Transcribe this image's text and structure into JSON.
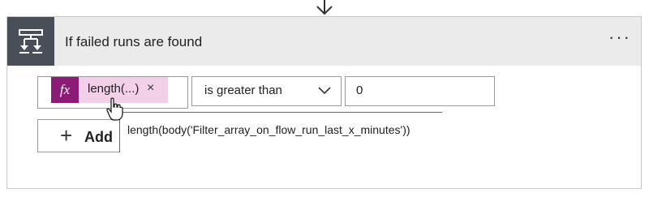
{
  "header": {
    "title": "If failed runs are found",
    "more_label": "···"
  },
  "condition": {
    "token": {
      "fx_label": "fx",
      "label": "length(...)",
      "remove_label": "×"
    },
    "operator": {
      "selected": "is greater than"
    },
    "value": "0",
    "tooltip": "length(body('Filter_array_on_flow_run_last_x_minutes'))"
  },
  "actions": {
    "add_plus": "+",
    "add_label": "Add"
  },
  "colors": {
    "header_bg": "#ebebeb",
    "icon_tile_bg": "#484f58",
    "fx_bg": "#8a1c78",
    "token_bg": "#f2d0e8"
  },
  "icons": {
    "arrow": "arrow-down-icon",
    "condition": "condition-icon",
    "dropdown": "chevron-down-icon",
    "cursor": "hand-cursor-icon"
  }
}
